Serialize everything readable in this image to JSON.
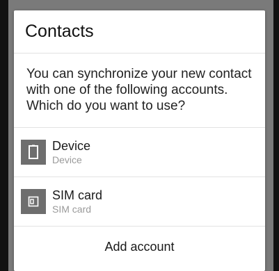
{
  "dialog": {
    "title": "Contacts",
    "message": "You can synchronize your new contact with one of the following accounts. Which do you want to use?",
    "accounts": [
      {
        "name": "Device",
        "subtitle": "Device",
        "icon": "phone-icon"
      },
      {
        "name": "SIM card",
        "subtitle": "SIM card",
        "icon": "sim-card-icon"
      }
    ],
    "add_account_label": "Add account"
  },
  "colors": {
    "backdrop": "#7a7a7a",
    "icon_bg": "#6e6e6e",
    "divider": "#e2e2e2"
  }
}
